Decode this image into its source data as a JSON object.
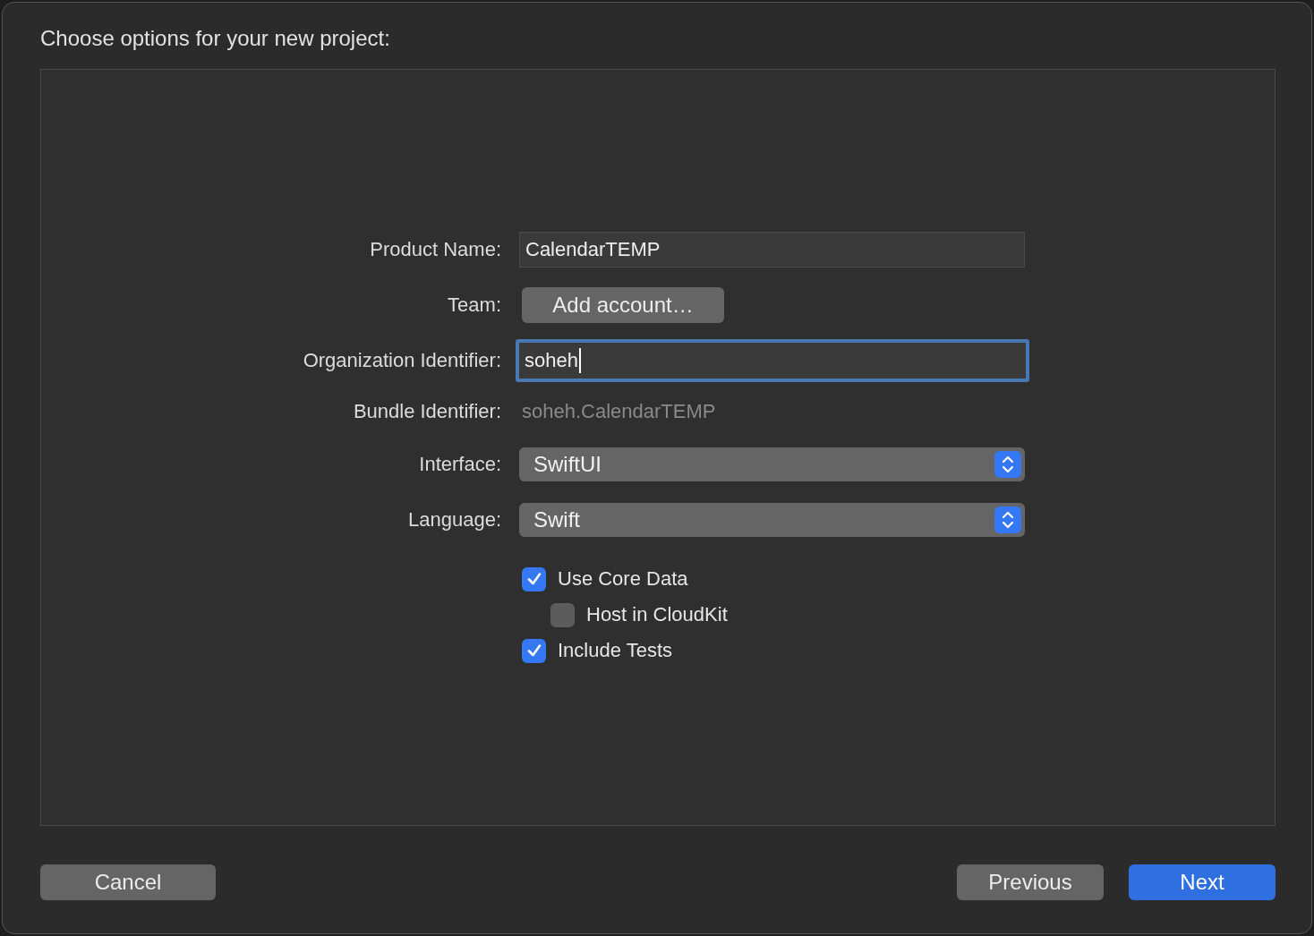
{
  "title": "Choose options for your new project:",
  "form": [
    {
      "kind": "text",
      "label": "Product Name:",
      "value": "CalendarTEMP",
      "focused": false
    },
    {
      "kind": "button",
      "label": "Team:",
      "value": "Add account…"
    },
    {
      "kind": "text",
      "label": "Organization Identifier:",
      "value": "soheh",
      "focused": true
    },
    {
      "kind": "static",
      "label": "Bundle Identifier:",
      "value": "soheh.CalendarTEMP"
    },
    {
      "kind": "popup",
      "label": "Interface:",
      "value": "SwiftUI"
    },
    {
      "kind": "popup",
      "label": "Language:",
      "value": "Swift"
    }
  ],
  "options": [
    {
      "label": "Use Core Data",
      "checked": true,
      "children": [
        {
          "label": "Host in CloudKit",
          "checked": false
        }
      ]
    },
    {
      "label": "Include Tests",
      "checked": true
    }
  ],
  "buttons": [
    {
      "label": "Cancel",
      "kind": "secondary"
    },
    {
      "label": "Previous",
      "kind": "secondary"
    },
    {
      "label": "Next",
      "kind": "primary"
    }
  ]
}
